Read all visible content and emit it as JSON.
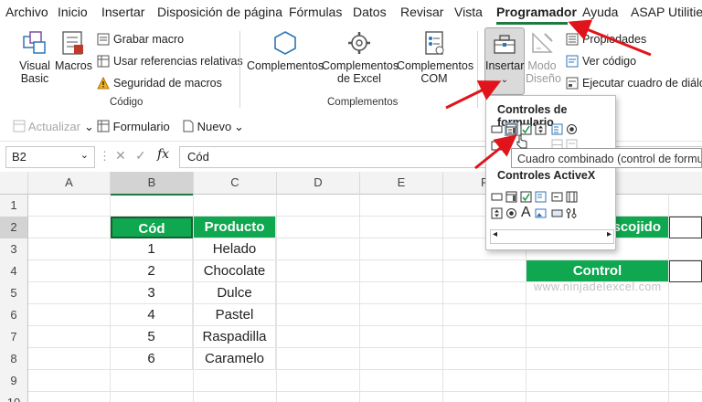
{
  "menu": {
    "items": [
      "Archivo",
      "Inicio",
      "Insertar",
      "Disposición de página",
      "Fórmulas",
      "Datos",
      "Revisar",
      "Vista",
      "Programador",
      "Ayuda",
      "ASAP Utilities"
    ],
    "active": "Programador"
  },
  "ribbon": {
    "codigo": {
      "visual_basic": [
        "Visual",
        "Basic"
      ],
      "macros": "Macros",
      "grabar_macro": "Grabar macro",
      "usar_referencias": "Usar referencias relativas",
      "seguridad": "Seguridad de macros",
      "label": "Código"
    },
    "complementos": {
      "complementos": "Complementos",
      "complementos_excel": [
        "Complementos",
        "de Excel"
      ],
      "complementos_com": [
        "Complementos",
        "COM"
      ],
      "label": "Complementos"
    },
    "controles": {
      "insertar": "Insertar",
      "modo_diseno": [
        "Modo",
        "Diseño"
      ],
      "propiedades": "Propiedades",
      "ver_codigo": "Ver código",
      "ejecutar": "Ejecutar cuadro de diálogo"
    }
  },
  "toolbar2": {
    "actualizar": "Actualizar",
    "formulario": "Formulario",
    "nuevo": "Nuevo"
  },
  "formula_bar": {
    "namebox": "B2",
    "content": "Cód",
    "fx": "fx"
  },
  "grid": {
    "columns": [
      "A",
      "B",
      "C",
      "D",
      "E",
      "F"
    ],
    "rows": [
      "1",
      "2",
      "3",
      "4",
      "5",
      "6",
      "7",
      "8",
      "9",
      "10"
    ],
    "headers": {
      "cod": "Cód",
      "producto": "Producto"
    },
    "data": [
      {
        "cod": "1",
        "producto": "Helado"
      },
      {
        "cod": "2",
        "producto": "Chocolate"
      },
      {
        "cod": "3",
        "producto": "Dulce"
      },
      {
        "cod": "4",
        "producto": "Pastel"
      },
      {
        "cod": "5",
        "producto": "Raspadilla"
      },
      {
        "cod": "6",
        "producto": "Caramelo"
      }
    ],
    "escojido_label": "scojido",
    "control_label": "Control",
    "watermark": "www.ninjadelexcel.com"
  },
  "dropdown": {
    "form_controls_title": "Controles de formulario",
    "activex_title": "Controles ActiveX",
    "tooltip": "Cuadro combinado (control de formulario)"
  },
  "colors": {
    "green": "#0fa74f",
    "accent": "#1f7a3f",
    "arrow": "#e0141b"
  }
}
